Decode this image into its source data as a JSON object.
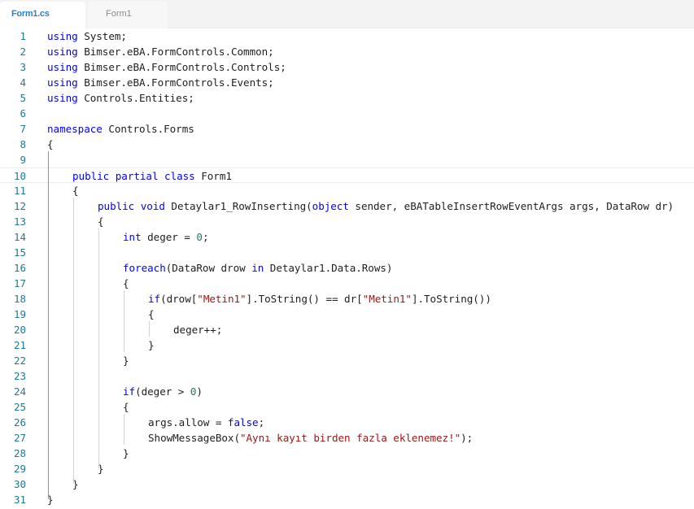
{
  "tabs": [
    {
      "label": "Form1.cs",
      "active": true
    },
    {
      "label": "Form1",
      "active": false
    }
  ],
  "editor": {
    "current_line": 10,
    "colors": {
      "keyword": "#0000ff",
      "number": "#098658",
      "string": "#a31515",
      "line_number": "#237893",
      "text": "#1e1e1e"
    },
    "lines": [
      {
        "n": "1",
        "indent": 0,
        "tokens": [
          [
            "kw",
            "using"
          ],
          [
            "t",
            " System;"
          ]
        ]
      },
      {
        "n": "2",
        "indent": 0,
        "tokens": [
          [
            "kw",
            "using"
          ],
          [
            "t",
            " Bimser.eBA.FormControls.Common;"
          ]
        ]
      },
      {
        "n": "3",
        "indent": 0,
        "tokens": [
          [
            "kw",
            "using"
          ],
          [
            "t",
            " Bimser.eBA.FormControls.Controls;"
          ]
        ]
      },
      {
        "n": "4",
        "indent": 0,
        "tokens": [
          [
            "kw",
            "using"
          ],
          [
            "t",
            " Bimser.eBA.FormControls.Events;"
          ]
        ]
      },
      {
        "n": "5",
        "indent": 0,
        "tokens": [
          [
            "kw",
            "using"
          ],
          [
            "t",
            " Controls.Entities;"
          ]
        ]
      },
      {
        "n": "6",
        "indent": 0,
        "tokens": []
      },
      {
        "n": "7",
        "indent": 0,
        "tokens": [
          [
            "kw",
            "namespace"
          ],
          [
            "t",
            " Controls.Forms"
          ]
        ]
      },
      {
        "n": "8",
        "indent": 0,
        "tokens": [
          [
            "t",
            "{"
          ]
        ]
      },
      {
        "n": "9",
        "indent": 0,
        "tokens": []
      },
      {
        "n": "10",
        "indent": 1,
        "tokens": [
          [
            "kw",
            "public"
          ],
          [
            "t",
            " "
          ],
          [
            "kw",
            "partial"
          ],
          [
            "t",
            " "
          ],
          [
            "kw",
            "class"
          ],
          [
            "t",
            " Form1"
          ]
        ]
      },
      {
        "n": "11",
        "indent": 1,
        "tokens": [
          [
            "t",
            "{"
          ]
        ]
      },
      {
        "n": "12",
        "indent": 2,
        "tokens": [
          [
            "kw",
            "public"
          ],
          [
            "t",
            " "
          ],
          [
            "kw",
            "void"
          ],
          [
            "t",
            " Detaylar1_RowInserting("
          ],
          [
            "kw",
            "object"
          ],
          [
            "t",
            " sender, eBATableInsertRowEventArgs args, DataRow dr)"
          ]
        ]
      },
      {
        "n": "13",
        "indent": 2,
        "tokens": [
          [
            "t",
            "{"
          ]
        ]
      },
      {
        "n": "14",
        "indent": 3,
        "tokens": [
          [
            "kw",
            "int"
          ],
          [
            "t",
            " deger = "
          ],
          [
            "num",
            "0"
          ],
          [
            "t",
            ";"
          ]
        ]
      },
      {
        "n": "15",
        "indent": 0,
        "tokens": []
      },
      {
        "n": "16",
        "indent": 3,
        "tokens": [
          [
            "kw",
            "foreach"
          ],
          [
            "t",
            "(DataRow drow "
          ],
          [
            "kw",
            "in"
          ],
          [
            "t",
            " Detaylar1.Data.Rows)"
          ]
        ]
      },
      {
        "n": "17",
        "indent": 3,
        "tokens": [
          [
            "t",
            "{"
          ]
        ]
      },
      {
        "n": "18",
        "indent": 4,
        "tokens": [
          [
            "kw",
            "if"
          ],
          [
            "t",
            "(drow["
          ],
          [
            "str",
            "\"Metin1\""
          ],
          [
            "t",
            "].ToString() == dr["
          ],
          [
            "str",
            "\"Metin1\""
          ],
          [
            "t",
            "].ToString())"
          ]
        ]
      },
      {
        "n": "19",
        "indent": 4,
        "tokens": [
          [
            "t",
            "{"
          ]
        ]
      },
      {
        "n": "20",
        "indent": 5,
        "tokens": [
          [
            "t",
            "deger++;"
          ]
        ]
      },
      {
        "n": "21",
        "indent": 4,
        "tokens": [
          [
            "t",
            "}"
          ]
        ]
      },
      {
        "n": "22",
        "indent": 3,
        "tokens": [
          [
            "t",
            "}"
          ]
        ]
      },
      {
        "n": "23",
        "indent": 0,
        "tokens": []
      },
      {
        "n": "24",
        "indent": 3,
        "tokens": [
          [
            "kw",
            "if"
          ],
          [
            "t",
            "(deger > "
          ],
          [
            "num",
            "0"
          ],
          [
            "t",
            ")"
          ]
        ]
      },
      {
        "n": "25",
        "indent": 3,
        "tokens": [
          [
            "t",
            "{"
          ]
        ]
      },
      {
        "n": "26",
        "indent": 4,
        "tokens": [
          [
            "t",
            "args.allow = "
          ],
          [
            "kw",
            "false"
          ],
          [
            "t",
            ";"
          ]
        ]
      },
      {
        "n": "27",
        "indent": 4,
        "tokens": [
          [
            "t",
            "ShowMessageBox("
          ],
          [
            "str",
            "\"Aynı kayıt birden fazla eklenemez!\""
          ],
          [
            "t",
            ");"
          ]
        ]
      },
      {
        "n": "28",
        "indent": 3,
        "tokens": [
          [
            "t",
            "}"
          ]
        ]
      },
      {
        "n": "29",
        "indent": 2,
        "tokens": [
          [
            "t",
            "}"
          ]
        ]
      },
      {
        "n": "30",
        "indent": 1,
        "tokens": [
          [
            "t",
            "}"
          ]
        ]
      },
      {
        "n": "31",
        "indent": 0,
        "tokens": [
          [
            "t",
            "}"
          ]
        ]
      }
    ]
  }
}
